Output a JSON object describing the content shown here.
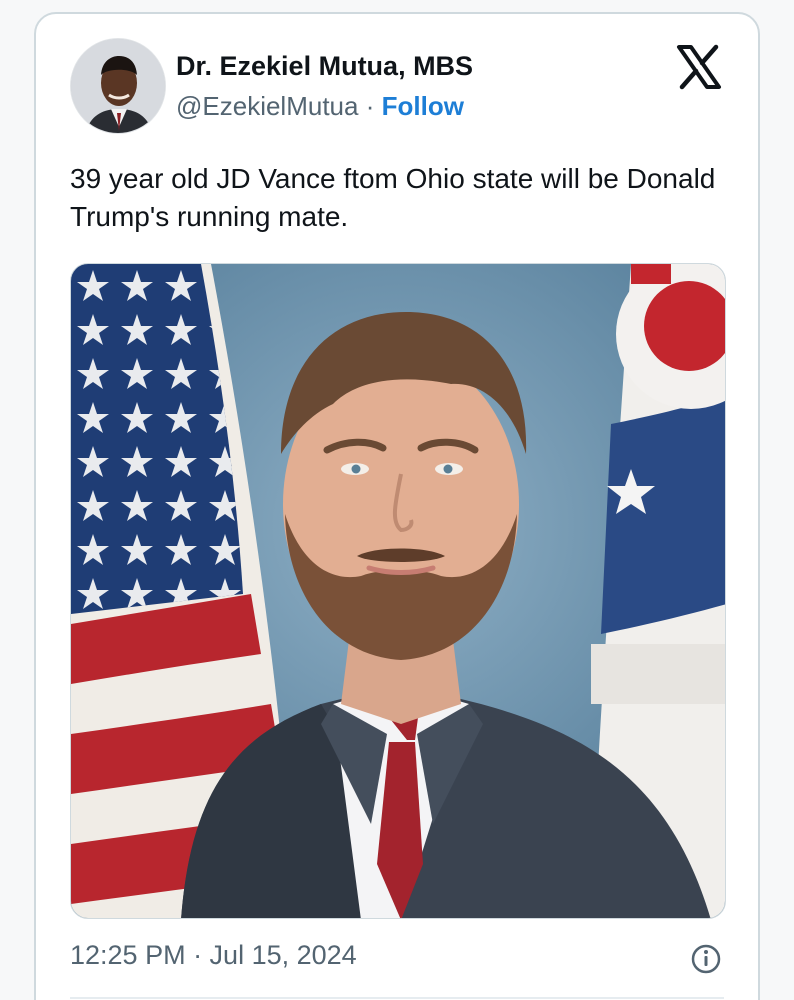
{
  "author": {
    "name": "Dr. Ezekiel Mutua, MBS",
    "handle": "@EzekielMutua",
    "separator": "·",
    "follow_label": "Follow"
  },
  "platform_icon": "x-logo-icon",
  "tweet": {
    "text": "39 year old JD Vance ftom Ohio state will be Donald Trump's running mate.",
    "timestamp": "12:25 PM · Jul 15, 2024"
  },
  "icons": {
    "info": "info-icon"
  },
  "colors": {
    "follow_blue": "#1d7ed6",
    "muted_text": "#536471",
    "card_border": "#cfd9de"
  }
}
